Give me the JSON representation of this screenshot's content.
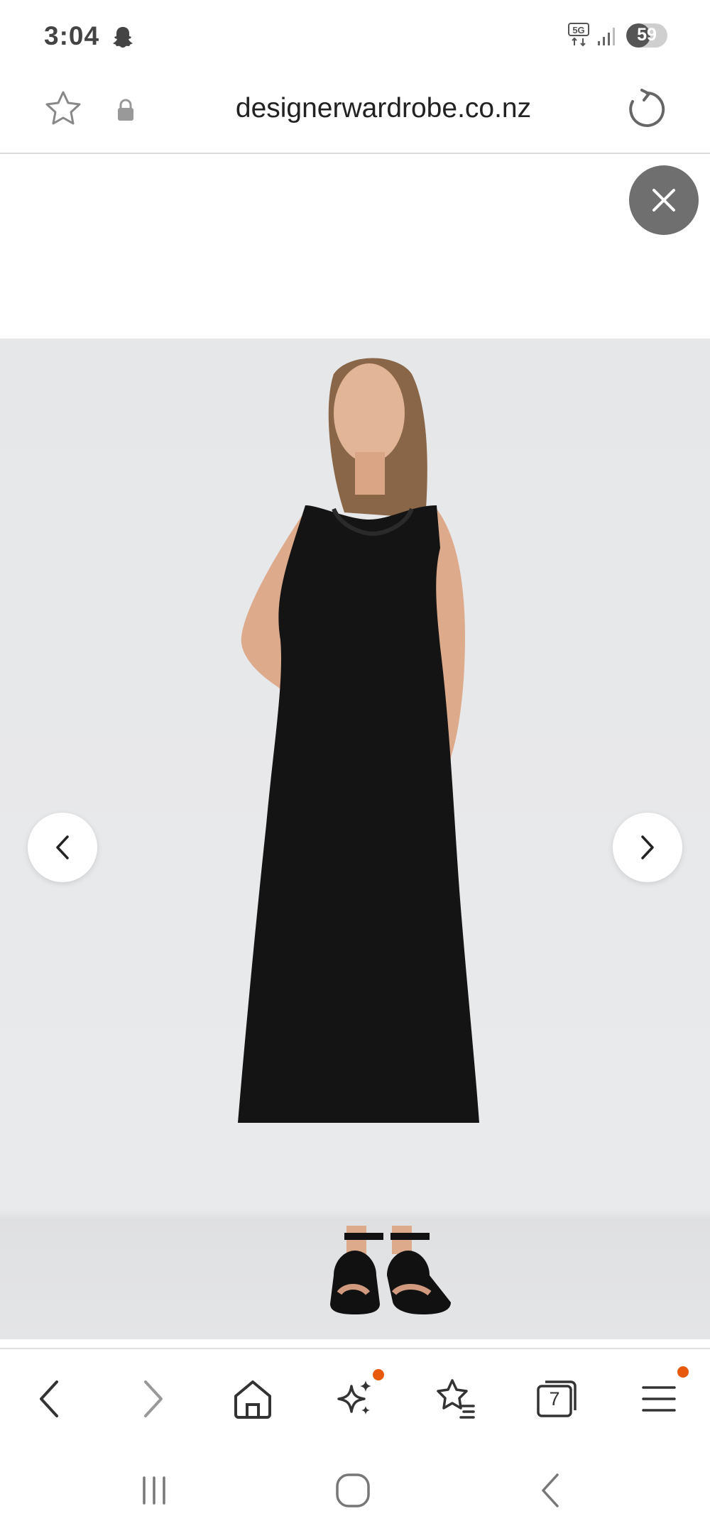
{
  "status_bar": {
    "time": "3:04",
    "network": "5G",
    "battery_level": "59",
    "icons": [
      "snapchat-ghost-icon",
      "5g-icon",
      "signal-icon",
      "battery-icon"
    ]
  },
  "browser": {
    "url": "designerwardrobe.co.nz",
    "icons": {
      "bookmark": "star-icon",
      "secure": "lock-icon",
      "reload": "reload-icon"
    }
  },
  "page": {
    "close_icon": "close-icon",
    "carousel": {
      "prev_icon": "chevron-left-icon",
      "next_icon": "chevron-right-icon"
    }
  },
  "toolbar": {
    "items": [
      {
        "name": "back",
        "icon": "arrow-left-icon"
      },
      {
        "name": "forward",
        "icon": "arrow-right-icon"
      },
      {
        "name": "home",
        "icon": "home-icon"
      },
      {
        "name": "ai",
        "icon": "sparkle-icon",
        "notification": true
      },
      {
        "name": "bookmarks",
        "icon": "star-list-icon"
      },
      {
        "name": "tabs",
        "icon": "tabs-icon",
        "count": "7"
      },
      {
        "name": "menu",
        "icon": "menu-icon",
        "notification": true
      }
    ],
    "notification_color": "#e8590c"
  },
  "system_nav": {
    "items": [
      "recents-icon",
      "home-circle-icon",
      "back-chevron-icon"
    ]
  }
}
